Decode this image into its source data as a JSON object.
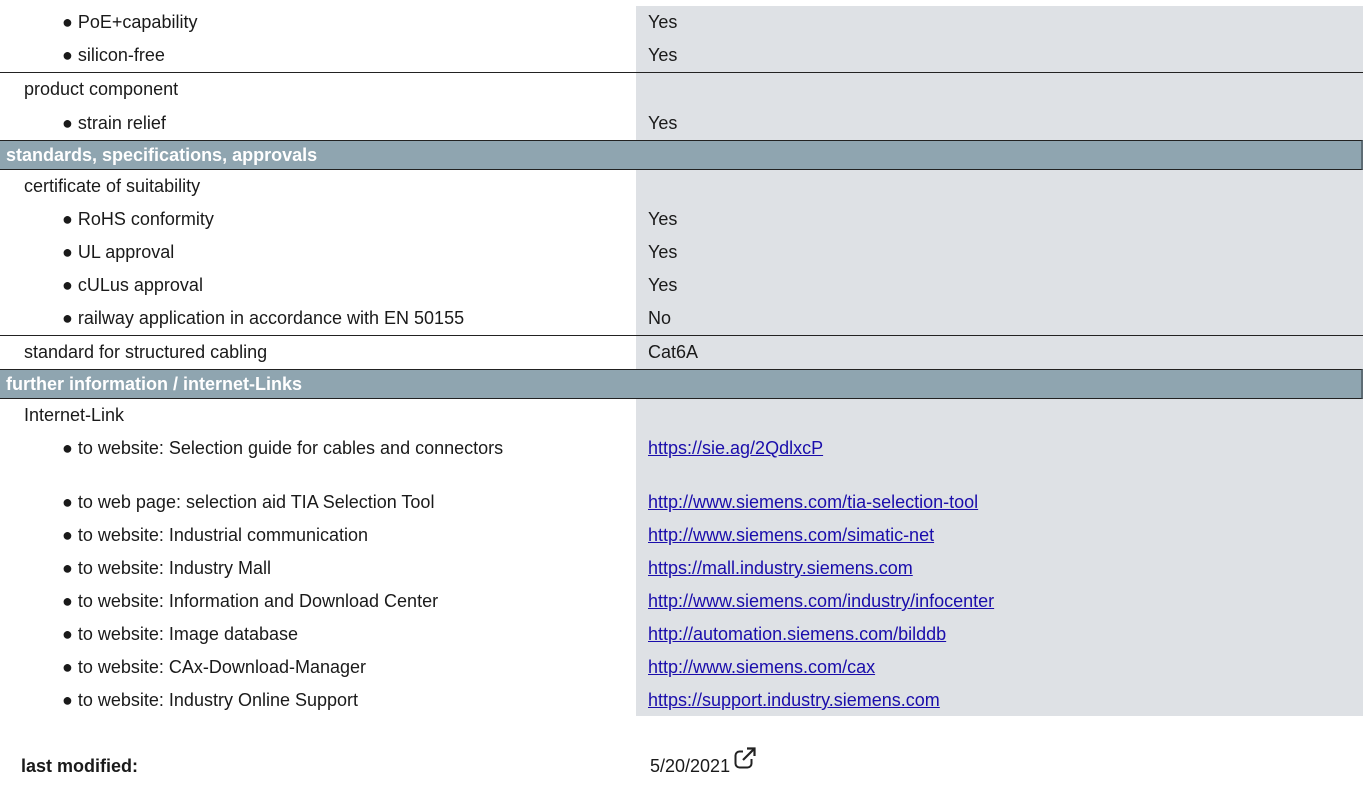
{
  "rows_top": [
    {
      "label": "● PoE+capability",
      "value": "Yes"
    },
    {
      "label": "● silicon-free",
      "value": "Yes"
    },
    {
      "label": "product component",
      "value": ""
    },
    {
      "label": "● strain relief",
      "value": "Yes"
    }
  ],
  "section1": "standards, specifications, approvals",
  "rows_standards": [
    {
      "label": "certificate of suitability",
      "value": ""
    },
    {
      "label": "● RoHS conformity",
      "value": "Yes"
    },
    {
      "label": "● UL approval",
      "value": "Yes"
    },
    {
      "label": "● cULus approval",
      "value": "Yes"
    },
    {
      "label": "● railway application in accordance with EN 50155",
      "value": "No"
    },
    {
      "label": "standard for structured cabling",
      "value": "Cat6A"
    }
  ],
  "section2": "further information / internet-Links",
  "links_header": "Internet-Link",
  "links": [
    {
      "label": "● to website: Selection guide for cables and connectors",
      "url": "https://sie.ag/2QdlxcP"
    },
    {
      "label": "● to web page: selection aid TIA Selection Tool",
      "url": "http://www.siemens.com/tia-selection-tool"
    },
    {
      "label": "● to website: Industrial communication",
      "url": "http://www.siemens.com/simatic-net"
    },
    {
      "label": "● to website: Industry Mall",
      "url": "https://mall.industry.siemens.com"
    },
    {
      "label": "● to website: Information and Download Center",
      "url": "http://www.siemens.com/industry/infocenter"
    },
    {
      "label": "● to website: Image database",
      "url": "http://automation.siemens.com/bilddb"
    },
    {
      "label": "● to website: CAx-Download-Manager",
      "url": "http://www.siemens.com/cax"
    },
    {
      "label": "● to website: Industry Online Support",
      "url": "https://support.industry.siemens.com"
    }
  ],
  "footer": {
    "label": "last modified:",
    "value": "5/20/2021",
    "icon": "external-link-icon"
  }
}
